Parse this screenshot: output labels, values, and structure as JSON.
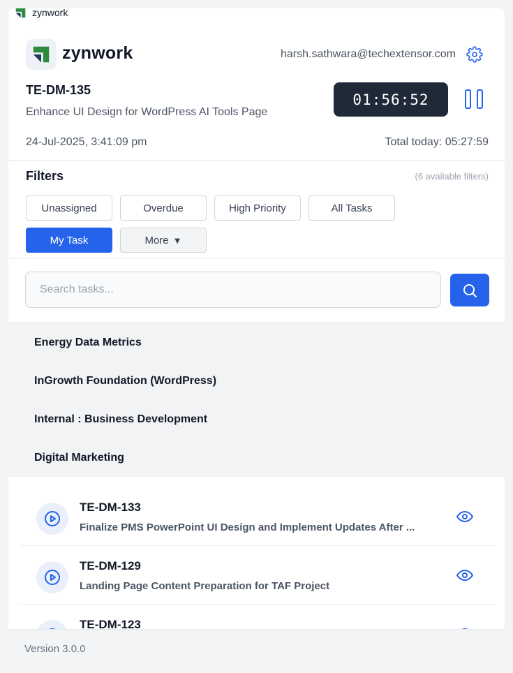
{
  "window": {
    "title": "zynwork"
  },
  "header": {
    "brand": "zynwork",
    "user_email": "harsh.sathwara@techextensor.com"
  },
  "current_task": {
    "id": "TE-DM-135",
    "title": "Enhance UI Design for WordPress AI Tools Page",
    "timer": "01:56:52",
    "started_at": "24-Jul-2025, 3:41:09 pm",
    "total_today": "Total today: 05:27:59"
  },
  "filters": {
    "title": "Filters",
    "available": "(6 available filters)",
    "chips": [
      "Unassigned",
      "Overdue",
      "High Priority",
      "All Tasks",
      "My Task",
      "More"
    ],
    "active": "My Task"
  },
  "search": {
    "placeholder": "Search tasks..."
  },
  "projects": [
    "Energy Data Metrics",
    "InGrowth Foundation (WordPress)",
    "Internal : Business Development",
    "Digital Marketing"
  ],
  "tasks": [
    {
      "id": "TE-DM-133",
      "title": "Finalize PMS PowerPoint UI Design and Implement Updates After ..."
    },
    {
      "id": "TE-DM-129",
      "title": "Landing Page Content Preparation for TAF Project"
    },
    {
      "id": "TE-DM-123",
      "title": ""
    }
  ],
  "footer": {
    "version": "Version 3.0.0"
  },
  "colors": {
    "accent": "#2563eb",
    "timer_bg": "#1f2937",
    "brand_green": "#2e8b3e",
    "brand_dark": "#1e3a5f"
  },
  "icons": [
    "zynwork-logo",
    "gear-icon",
    "pause-icon",
    "search-icon",
    "play-icon",
    "eye-icon"
  ]
}
